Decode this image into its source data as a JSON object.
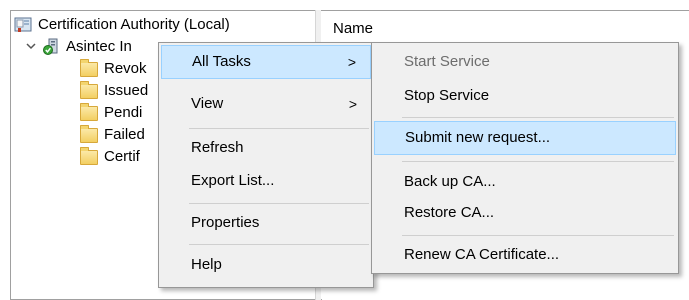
{
  "tree": {
    "root_label": "Certification Authority (Local)",
    "ca_label": "Asintec In",
    "folders": [
      "Revok",
      "Issued",
      "Pendi",
      "Failed",
      "Certif"
    ]
  },
  "list": {
    "column_header": "Name"
  },
  "context_menu": {
    "items": [
      {
        "label": "All Tasks",
        "has_submenu": true,
        "highlighted": true
      },
      {
        "label": "View",
        "has_submenu": true
      },
      {
        "label": "Refresh"
      },
      {
        "label": "Export List..."
      },
      {
        "label": "Properties"
      },
      {
        "label": "Help"
      }
    ],
    "submenu_arrow": ">"
  },
  "submenu": {
    "items": [
      {
        "label": "Start Service",
        "disabled": true
      },
      {
        "label": "Stop Service"
      },
      {
        "label": "Submit new request...",
        "highlighted": true
      },
      {
        "label": "Back up CA..."
      },
      {
        "label": "Restore CA..."
      },
      {
        "label": "Renew CA Certificate..."
      }
    ]
  },
  "colors": {
    "highlight_bg": "#cce8ff",
    "highlight_border": "#99d1ff",
    "menu_bg": "#f0f0f0"
  },
  "icons": {
    "root": "certification-authority-icon",
    "ca": "ca-server-icon",
    "folder": "folder-icon",
    "expand": "chevron-down-icon"
  }
}
